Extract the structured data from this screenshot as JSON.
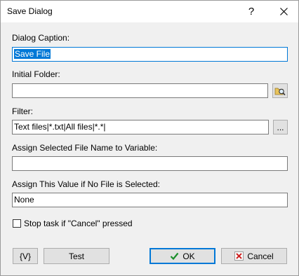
{
  "window": {
    "title": "Save Dialog",
    "help_glyph": "?",
    "close_glyph": "✕"
  },
  "fields": {
    "caption": {
      "label": "Dialog Caption:",
      "value": "Save File"
    },
    "initial_folder": {
      "label": "Initial Folder:",
      "value": ""
    },
    "filter": {
      "label": "Filter:",
      "value": "Text files|*.txt|All files|*.*|"
    },
    "assign_var": {
      "label": "Assign Selected File Name to Variable:",
      "value": ""
    },
    "no_file_value": {
      "label": "Assign This Value if No File is Selected:",
      "value": "None"
    }
  },
  "buttons": {
    "browse_icon": "folder-search-icon",
    "ellipsis": "...",
    "variables": "{V}",
    "test": "Test",
    "ok": "OK",
    "cancel": "Cancel"
  },
  "checkbox": {
    "label": "Stop task if \"Cancel\" pressed",
    "checked": false
  },
  "colors": {
    "accent": "#0078d7",
    "ok_check": "#1a8f2a",
    "cancel_x": "#cc2222"
  }
}
